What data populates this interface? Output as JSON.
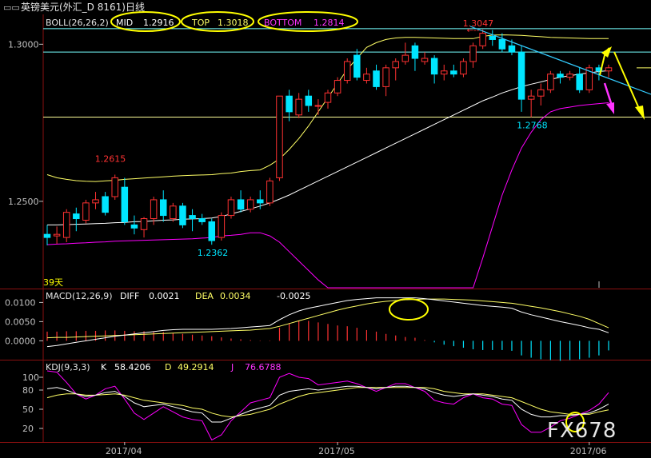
{
  "window": {
    "title": "英镑美元(外汇_D 8161)日线"
  },
  "boll": {
    "name": "BOLL(26,26,2)",
    "mid_label": "MID",
    "mid_value": "1.2916",
    "top_label": "TOP",
    "top_value": "1.3018",
    "bottom_label": "BOTTOM",
    "bottom_value": "1.2814"
  },
  "macd": {
    "name": "MACD(12,26,9)",
    "diff_label": "DIFF",
    "diff_value": "0.0021",
    "dea_label": "DEA",
    "dea_value": "0.0034",
    "macd_value": "-0.0025"
  },
  "kdj": {
    "name": "KDJ(9,3,3)",
    "k_label": "K",
    "k_value": "58.4206",
    "d_label": "D",
    "d_value": "49.2914",
    "j_label": "J",
    "j_value": "76.6788"
  },
  "corner_label": "39天",
  "watermark": "FX678",
  "colors": {
    "up": "#ff3232",
    "down": "#00e5ff",
    "mid": "#ffffff",
    "band": "#ffff66",
    "bottom_band": "#ff00ff",
    "support": "#ffff99",
    "resistance": "#7ff",
    "annotation": "#ffff00",
    "arrow_down": "#ff33ff",
    "axis": "#c0c0c0"
  },
  "chart_data": [
    {
      "type": "candlestick",
      "title": "英镑美元(外汇_D 8161)日线",
      "y_ticks": [
        "1.3000",
        "1.2500"
      ],
      "y_tick_values": [
        1.3,
        1.25
      ],
      "ylim": [
        1.2225,
        1.3095
      ],
      "x_tick_labels": [
        "2017/04",
        "2017/05",
        "2017/06"
      ],
      "x_tick_index": [
        8,
        30,
        56
      ],
      "count": 59,
      "candles": [
        [
          1.2395,
          1.2425,
          1.236,
          1.2385
        ],
        [
          1.239,
          1.242,
          1.2365,
          1.2395
        ],
        [
          1.2385,
          1.2475,
          1.237,
          1.2465
        ],
        [
          1.246,
          1.248,
          1.2405,
          1.2445
        ],
        [
          1.244,
          1.2505,
          1.243,
          1.2495
        ],
        [
          1.2495,
          1.253,
          1.2475,
          1.2505
        ],
        [
          1.2515,
          1.253,
          1.2455,
          1.2465
        ],
        [
          1.2515,
          1.2585,
          1.2505,
          1.2575
        ],
        [
          1.2545,
          1.2575,
          1.2425,
          1.2435
        ],
        [
          1.2425,
          1.2455,
          1.2395,
          1.2415
        ],
        [
          1.241,
          1.245,
          1.2385,
          1.2445
        ],
        [
          1.2445,
          1.2515,
          1.2425,
          1.2505
        ],
        [
          1.2505,
          1.2535,
          1.2435,
          1.2455
        ],
        [
          1.2445,
          1.2495,
          1.2435,
          1.2485
        ],
        [
          1.2485,
          1.2495,
          1.2415,
          1.2425
        ],
        [
          1.2455,
          1.2475,
          1.2405,
          1.2445
        ],
        [
          1.2445,
          1.246,
          1.2425,
          1.2435
        ],
        [
          1.2435,
          1.2445,
          1.2362,
          1.2375
        ],
        [
          1.2385,
          1.2465,
          1.2375,
          1.2455
        ],
        [
          1.2455,
          1.2515,
          1.2445,
          1.2505
        ],
        [
          1.2505,
          1.2535,
          1.2465,
          1.2475
        ],
        [
          1.2475,
          1.2515,
          1.2465,
          1.2505
        ],
        [
          1.2505,
          1.2535,
          1.2475,
          1.2495
        ],
        [
          1.2495,
          1.2575,
          1.2485,
          1.2565
        ],
        [
          1.2575,
          1.2735,
          1.2565,
          1.2835
        ],
        [
          1.2835,
          1.2855,
          1.2755,
          1.2785
        ],
        [
          1.2775,
          1.2845,
          1.2765,
          1.2825
        ],
        [
          1.2835,
          1.2855,
          1.2785,
          1.2805
        ],
        [
          1.2805,
          1.2825,
          1.2775,
          1.2805
        ],
        [
          1.2815,
          1.2855,
          1.2795,
          1.2845
        ],
        [
          1.2845,
          1.2895,
          1.2835,
          1.2885
        ],
        [
          1.2885,
          1.2955,
          1.2875,
          1.2945
        ],
        [
          1.2965,
          1.2985,
          1.2885,
          1.2895
        ],
        [
          1.2885,
          1.2925,
          1.2875,
          1.2905
        ],
        [
          1.2915,
          1.2935,
          1.2855,
          1.2865
        ],
        [
          1.2865,
          1.2935,
          1.2835,
          1.2925
        ],
        [
          1.2925,
          1.2955,
          1.2885,
          1.2945
        ],
        [
          1.2945,
          1.3005,
          1.2935,
          1.2965
        ],
        [
          1.2995,
          1.3005,
          1.2915,
          1.2955
        ],
        [
          1.2945,
          1.2975,
          1.2935,
          1.2955
        ],
        [
          1.2955,
          1.2965,
          1.2875,
          1.2905
        ],
        [
          1.2905,
          1.2935,
          1.2885,
          1.2915
        ],
        [
          1.2915,
          1.2935,
          1.2895,
          1.2905
        ],
        [
          1.2905,
          1.2955,
          1.2895,
          1.2945
        ],
        [
          1.2945,
          1.3005,
          1.2925,
          1.2995
        ],
        [
          1.2995,
          1.3047,
          1.2985,
          1.3035
        ],
        [
          1.3025,
          1.3045,
          1.2995,
          1.3015
        ],
        [
          1.3015,
          1.3035,
          1.2975,
          1.2985
        ],
        [
          1.2995,
          1.3015,
          1.2965,
          1.2975
        ],
        [
          1.2975,
          1.2995,
          1.2785,
          1.2825
        ],
        [
          1.2825,
          1.2855,
          1.2768,
          1.2835
        ],
        [
          1.2835,
          1.2875,
          1.2805,
          1.2855
        ],
        [
          1.2855,
          1.2915,
          1.2845,
          1.2905
        ],
        [
          1.2905,
          1.2915,
          1.2875,
          1.2895
        ],
        [
          1.2895,
          1.2915,
          1.2885,
          1.2905
        ],
        [
          1.2905,
          1.2925,
          1.2845,
          1.2855
        ],
        [
          1.2855,
          1.2935,
          1.2845,
          1.2925
        ],
        [
          1.2925,
          1.2935,
          1.2885,
          1.2915
        ],
        [
          1.2915,
          1.2935,
          1.2895,
          1.2925
        ]
      ],
      "mid": [
        1.2425,
        1.2425,
        1.2426,
        1.2427,
        1.2428,
        1.2429,
        1.243,
        1.2432,
        1.2433,
        1.2435,
        1.2436,
        1.2438,
        1.244,
        1.2441,
        1.2443,
        1.2444,
        1.2445,
        1.2447,
        1.2452,
        1.246,
        1.2468,
        1.2476,
        1.2485,
        1.2495,
        1.2507,
        1.252,
        1.2535,
        1.255,
        1.2565,
        1.258,
        1.2595,
        1.261,
        1.2625,
        1.264,
        1.2655,
        1.267,
        1.2685,
        1.27,
        1.2715,
        1.273,
        1.2745,
        1.276,
        1.2775,
        1.279,
        1.2805,
        1.282,
        1.2832,
        1.2845,
        1.2855,
        1.2865,
        1.2873,
        1.288,
        1.2888,
        1.2895,
        1.29,
        1.2905,
        1.2909,
        1.2913,
        1.2916
      ],
      "top": [
        1.2585,
        1.2575,
        1.257,
        1.2566,
        1.2564,
        1.2563,
        1.2565,
        1.2567,
        1.257,
        1.2572,
        1.2574,
        1.2576,
        1.2578,
        1.258,
        1.2582,
        1.2583,
        1.2584,
        1.2585,
        1.2588,
        1.259,
        1.2595,
        1.2598,
        1.26,
        1.2615,
        1.2635,
        1.2665,
        1.27,
        1.274,
        1.2785,
        1.283,
        1.2875,
        1.292,
        1.2955,
        1.299,
        1.3005,
        1.3015,
        1.302,
        1.3022,
        1.3022,
        1.3021,
        1.302,
        1.3019,
        1.3018,
        1.3018,
        1.3018,
        1.3025,
        1.3029,
        1.303,
        1.3029,
        1.3028,
        1.3026,
        1.3024,
        1.3022,
        1.3021,
        1.302,
        1.3019,
        1.3018,
        1.3018,
        1.3018
      ],
      "bottom": [
        1.2362,
        1.2364,
        1.2365,
        1.2367,
        1.2368,
        1.237,
        1.2371,
        1.2373,
        1.2374,
        1.2375,
        1.2376,
        1.2377,
        1.2378,
        1.2379,
        1.238,
        1.2381,
        1.2383,
        1.2385,
        1.239,
        1.2392,
        1.2395,
        1.24,
        1.24,
        1.239,
        1.237,
        1.234,
        1.231,
        1.228,
        1.225,
        1.222,
        1.219,
        1.216,
        1.213,
        1.21,
        1.207,
        1.204,
        1.202,
        1.2,
        1.199,
        1.198,
        1.2,
        1.203,
        1.208,
        1.214,
        1.222,
        1.232,
        1.242,
        1.252,
        1.26,
        1.267,
        1.272,
        1.276,
        1.2785,
        1.2795,
        1.28,
        1.2805,
        1.2808,
        1.2811,
        1.2814
      ],
      "price_labels": [
        {
          "text": "1.2615",
          "index": 7,
          "value": 1.2615,
          "color": "up"
        },
        {
          "text": "1.2362",
          "index": 17,
          "value": 1.2362,
          "color": "down"
        },
        {
          "text": "1.3047",
          "index": 45,
          "value": 1.3047,
          "color": "up"
        },
        {
          "text": "1.2768",
          "index": 50,
          "value": 1.2768,
          "color": "down"
        }
      ],
      "support_level": 1.2768,
      "resistance_level": 1.3047,
      "mid_level": 1.2975
    },
    {
      "type": "macd",
      "title": "MACD(12,26,9)",
      "y_ticks": [
        "0.0100",
        "0.0050",
        "0.0000"
      ],
      "y_tick_values": [
        0.01,
        0.005,
        0.0
      ],
      "ylim": [
        -0.0045,
        0.013
      ],
      "diff": [
        -0.0015,
        -0.0012,
        -0.0008,
        -0.0004,
        0.0,
        0.0004,
        0.0008,
        0.0012,
        0.0015,
        0.0018,
        0.0021,
        0.0024,
        0.0027,
        0.0029,
        0.003,
        0.003,
        0.003,
        0.003,
        0.0031,
        0.0032,
        0.0034,
        0.0036,
        0.0038,
        0.004,
        0.0055,
        0.0068,
        0.0078,
        0.0085,
        0.009,
        0.0095,
        0.01,
        0.0105,
        0.0108,
        0.011,
        0.0112,
        0.0112,
        0.0112,
        0.0112,
        0.0112,
        0.011,
        0.0107,
        0.0104,
        0.0101,
        0.0098,
        0.0095,
        0.0092,
        0.009,
        0.0088,
        0.0085,
        0.0075,
        0.0068,
        0.0062,
        0.0056,
        0.005,
        0.0045,
        0.004,
        0.0034,
        0.003,
        0.0021
      ],
      "dea": [
        0.0008,
        0.0009,
        0.0009,
        0.001,
        0.0011,
        0.0012,
        0.0013,
        0.0014,
        0.0015,
        0.0016,
        0.0017,
        0.0018,
        0.0019,
        0.002,
        0.0021,
        0.0022,
        0.0023,
        0.0024,
        0.0025,
        0.0026,
        0.0027,
        0.0028,
        0.003,
        0.0032,
        0.0038,
        0.0045,
        0.0052,
        0.0059,
        0.0066,
        0.0073,
        0.008,
        0.0086,
        0.0091,
        0.0096,
        0.01,
        0.0103,
        0.0105,
        0.0107,
        0.0108,
        0.0109,
        0.0109,
        0.0109,
        0.0108,
        0.0107,
        0.0106,
        0.0104,
        0.0102,
        0.01,
        0.0098,
        0.0094,
        0.009,
        0.0086,
        0.0081,
        0.0076,
        0.007,
        0.0064,
        0.0056,
        0.0045,
        0.0034
      ],
      "hist": [
        0.0024,
        0.0024,
        0.0025,
        0.0025,
        0.0026,
        0.0026,
        0.0027,
        0.0027,
        0.0026,
        0.0025,
        0.0025,
        0.0024,
        0.0023,
        0.002,
        0.0018,
        0.0016,
        0.0014,
        0.0012,
        0.0009,
        0.0006,
        0.0004,
        0.0002,
        0.0001,
        0.0001,
        0.0034,
        0.0046,
        0.0052,
        0.0052,
        0.0048,
        0.0044,
        0.004,
        0.0038,
        0.0034,
        0.0028,
        0.0024,
        0.0018,
        0.0014,
        0.001,
        0.0008,
        0.0002,
        -0.0004,
        -0.001,
        -0.0014,
        -0.0018,
        -0.0022,
        -0.0024,
        -0.0024,
        -0.0024,
        -0.0026,
        -0.0038,
        -0.0044,
        -0.0048,
        -0.005,
        -0.0052,
        -0.005,
        -0.0048,
        -0.0044,
        -0.0038,
        -0.0025
      ]
    },
    {
      "type": "kdj",
      "title": "KDJ(9,3,3)",
      "y_ticks": [
        "100",
        "80",
        "50",
        "20"
      ],
      "y_tick_values": [
        100,
        80,
        50,
        20
      ],
      "ylim": [
        0,
        125
      ],
      "k": [
        82,
        84,
        80,
        74,
        70,
        72,
        76,
        78,
        70,
        60,
        54,
        56,
        58,
        54,
        50,
        46,
        44,
        30,
        30,
        36,
        42,
        48,
        52,
        56,
        72,
        78,
        80,
        82,
        80,
        82,
        84,
        86,
        86,
        84,
        82,
        84,
        86,
        86,
        84,
        82,
        76,
        72,
        70,
        72,
        74,
        72,
        70,
        66,
        64,
        50,
        42,
        38,
        38,
        40,
        40,
        42,
        44,
        50,
        58
      ],
      "d": [
        68,
        72,
        74,
        74,
        72,
        72,
        73,
        74,
        72,
        68,
        64,
        62,
        60,
        58,
        56,
        52,
        50,
        44,
        40,
        38,
        40,
        42,
        46,
        50,
        58,
        64,
        70,
        74,
        76,
        78,
        80,
        82,
        84,
        84,
        84,
        84,
        84,
        84,
        84,
        84,
        82,
        78,
        76,
        74,
        74,
        74,
        72,
        70,
        68,
        62,
        56,
        50,
        46,
        44,
        42,
        42,
        42,
        46,
        49
      ],
      "j": [
        110,
        108,
        92,
        74,
        66,
        72,
        82,
        86,
        66,
        44,
        34,
        44,
        54,
        46,
        38,
        34,
        32,
        2,
        10,
        32,
        46,
        60,
        64,
        68,
        100,
        106,
        100,
        98,
        88,
        90,
        92,
        94,
        90,
        84,
        78,
        84,
        90,
        90,
        84,
        78,
        64,
        60,
        58,
        68,
        74,
        68,
        66,
        58,
        56,
        26,
        14,
        14,
        22,
        32,
        36,
        42,
        48,
        58,
        76
      ]
    }
  ]
}
